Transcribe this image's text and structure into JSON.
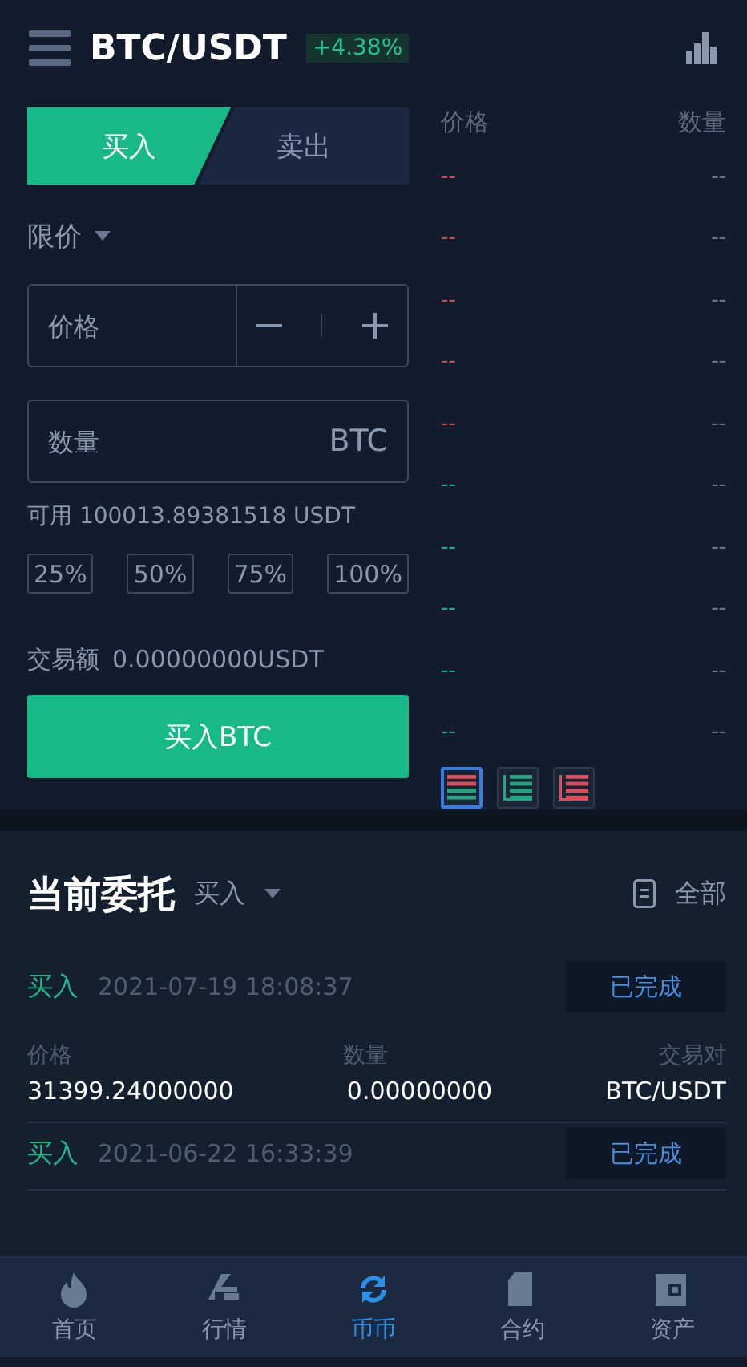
{
  "header": {
    "pair": "BTC/USDT",
    "change": "+4.38%"
  },
  "trade_tabs": [
    {
      "label": "买入",
      "selected": true
    },
    {
      "label": "卖出",
      "selected": false
    }
  ],
  "order_type": "限价",
  "price_field": {
    "placeholder": "价格"
  },
  "amount_field": {
    "placeholder": "数量",
    "unit": "BTC"
  },
  "available": "可用 100013.89381518 USDT",
  "percent_buttons": [
    "25%",
    "50%",
    "75%",
    "100%"
  ],
  "turnover": {
    "label": "交易额",
    "value": "0.00000000USDT"
  },
  "submit_button": "买入BTC",
  "order_book": {
    "columns": [
      "价格",
      "数量"
    ],
    "rows": [
      {
        "price": "--",
        "amount": "--",
        "color": "#c9505d"
      },
      {
        "price": "--",
        "amount": "--",
        "color": "#c9505d"
      },
      {
        "price": "--",
        "amount": "--",
        "color": "#c9505d"
      },
      {
        "price": "--",
        "amount": "--",
        "color": "#c9505d"
      },
      {
        "price": "--",
        "amount": "--",
        "color": "#c9505d"
      },
      {
        "price": "--",
        "amount": "--",
        "color": "#24b48a"
      },
      {
        "price": "--",
        "amount": "--",
        "color": "#24b48a"
      },
      {
        "price": "--",
        "amount": "--",
        "color": "#24b48a"
      },
      {
        "price": "--",
        "amount": "--",
        "color": "#24b48a"
      },
      {
        "price": "--",
        "amount": "--",
        "color": "#24b48a"
      }
    ],
    "depth_modes": [
      {
        "kind": "both",
        "selected": true
      },
      {
        "kind": "bids",
        "selected": false
      },
      {
        "kind": "asks",
        "selected": false
      }
    ]
  },
  "orders": {
    "title": "当前委托",
    "filter": "买入",
    "all_link": "全部",
    "items": [
      {
        "side": "买入",
        "time": "2021-07-19 18:08:37",
        "status": "已完成",
        "labels": [
          "价格",
          "数量",
          "交易对"
        ],
        "values": [
          "31399.24000000",
          "0.00000000",
          "BTC/USDT"
        ]
      },
      {
        "side": "买入",
        "time": "2021-06-22 16:33:39",
        "status": "已完成"
      }
    ]
  },
  "nav": [
    {
      "kind": "home",
      "label": "首页",
      "selected": false
    },
    {
      "kind": "market",
      "label": "行情",
      "selected": false
    },
    {
      "kind": "spot",
      "label": "币币",
      "selected": true
    },
    {
      "kind": "contract",
      "label": "合约",
      "selected": false
    },
    {
      "kind": "assets",
      "label": "资产",
      "selected": false
    }
  ]
}
